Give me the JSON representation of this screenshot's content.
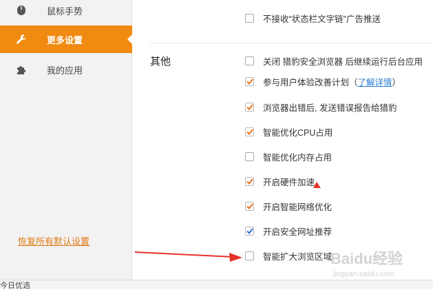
{
  "sidebar": {
    "items": [
      {
        "label": "鼠标手势",
        "icon": "mouse-icon",
        "active": false
      },
      {
        "label": "更多设置",
        "icon": "wrench-icon",
        "active": true
      },
      {
        "label": "我的应用",
        "icon": "puzzle-icon",
        "active": false
      }
    ],
    "restore_label": "恢复所有默认设置"
  },
  "top_option": {
    "label": "不接收“状态栏文字链”广告推送",
    "checked": false
  },
  "section": {
    "title": "其他",
    "options": [
      {
        "label": "关闭 猎豹安全浏览器 后继续运行后台应用",
        "checked": false
      },
      {
        "label_prefix": "参与用户体验改善计划（",
        "link": "了解详情",
        "label_suffix": "）",
        "checked": true
      },
      {
        "label": "浏览器出错后, 发送错误报告给猎豹",
        "checked": true
      },
      {
        "label": "智能优化CPU占用",
        "checked": true
      },
      {
        "label": "智能优化内存占用",
        "checked": false
      },
      {
        "label": "开启硬件加速",
        "checked": true
      },
      {
        "label": "开启智能网络优化",
        "checked": true
      },
      {
        "label": "开启安全网址推荐",
        "checked": true
      },
      {
        "label": "智能扩大浏览区域",
        "checked": false
      }
    ]
  },
  "bottom_bar": {
    "text": "今日优选"
  },
  "watermark": {
    "brand": "Baidu经验",
    "url": "jingyan.baidu.com"
  },
  "colors": {
    "accent": "#f08a10",
    "check_orange": "#e8711a",
    "check_blue": "#2a6fd6",
    "annotation_red": "#e8302a",
    "link": "#2a7dd1"
  }
}
